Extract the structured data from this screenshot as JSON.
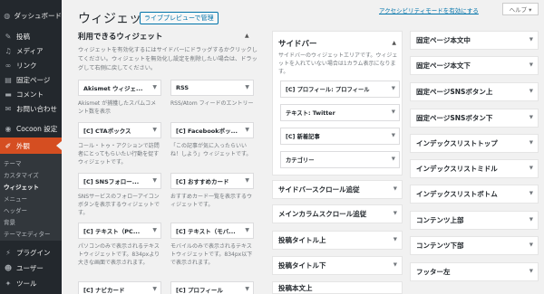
{
  "admin_menu": [
    {
      "label": "ダッシュボード",
      "icon": "dashboard-icon",
      "glyph": "◍"
    },
    {
      "label": "投稿",
      "icon": "pin-icon",
      "glyph": "✎"
    },
    {
      "label": "メディア",
      "icon": "media-icon",
      "glyph": "♫"
    },
    {
      "label": "リンク",
      "icon": "link-icon",
      "glyph": "∞"
    },
    {
      "label": "固定ページ",
      "icon": "page-icon",
      "glyph": "▤"
    },
    {
      "label": "コメント",
      "icon": "comment-icon",
      "glyph": "▬"
    },
    {
      "label": "お問い合わせ",
      "icon": "mail-icon",
      "glyph": "✉"
    },
    {
      "label": "Cocoon 設定",
      "icon": "cocoon-icon",
      "glyph": "◉"
    },
    {
      "label": "外観",
      "icon": "paintbrush-icon",
      "glyph": "✐"
    },
    {
      "label": "プラグイン",
      "icon": "plugin-icon",
      "glyph": "⚡"
    },
    {
      "label": "ユーザー",
      "icon": "user-icon",
      "glyph": "☻"
    },
    {
      "label": "ツール",
      "icon": "wrench-icon",
      "glyph": "✦"
    }
  ],
  "appearance_submenu": [
    "テーマ",
    "カスタマイズ",
    "ウィジェット",
    "メニュー",
    "ヘッダー",
    "背景",
    "テーマエディター"
  ],
  "header": {
    "title": "ウィジェット",
    "live_preview": "ライブプレビューで管理",
    "accessibility": "アクセシビリティモードを有効にする",
    "help": "ヘルプ ▾"
  },
  "available": {
    "title": "利用できるウィジェット",
    "description": "ウィジェットを有効化するにはサイドバーにドラッグするかクリックしてください。ウィジェットを無効化し設定を削除したい場合は、ドラッグして右側に戻してください。",
    "widgets": [
      {
        "name": "Akismet ウィジェ...",
        "desc": "Akismet が捕獲したスパムコメント数を表示"
      },
      {
        "name": "RSS",
        "desc": "RSS/Atom フィードのエントリー"
      },
      {
        "name": "[C] CTAボックス",
        "desc": "コール・トゥ・アクションで訪問者にとってもらいたい行動を促すウィジェットです。"
      },
      {
        "name": "[C] Facebookボッ...",
        "desc": "「この記事が気に入ったらいいね！しよう」ウィジェットです。"
      },
      {
        "name": "[C] SNSフォロー...",
        "desc": "SNSサービスのフォローアイコンボタンを表示するウィジェットです。"
      },
      {
        "name": "[C] おすすめカード",
        "desc": "おすすめカード一覧を表示するウィジェットです。"
      },
      {
        "name": "[C] テキスト（PC...",
        "desc": "パソコンのみで表示されるテキストウィジェットです。834pxより大きな画面で表示されます。"
      },
      {
        "name": "[C] テキスト（モバ...",
        "desc": "モバイルのみで表示されるテキストウィジェットです。834px以下で表示されます。"
      },
      {
        "name": "[C] ナビカード",
        "desc": ""
      },
      {
        "name": "[C] プロフィール",
        "desc": ""
      }
    ]
  },
  "sidebar_area": {
    "title": "サイドバー",
    "description": "サイドバーのウィジェットエリアです。ウィジェットを入れていない場合は1カラム表示になります。",
    "widgets": [
      "[C] プロフィール: プロフィール",
      "テキスト: Twitter",
      "[C] 新着記事",
      "カテゴリー"
    ]
  },
  "middle_areas": [
    "サイドバースクロール追従",
    "メインカラムスクロール追従",
    "投稿タイトル上",
    "投稿タイトル下",
    "投稿本文上"
  ],
  "right_areas": [
    "固定ページ本文中",
    "固定ページ本文下",
    "固定ページSNSボタン上",
    "固定ページSNSボタン下",
    "インデックスリストトップ",
    "インデックスリストミドル",
    "インデックスリストボトム",
    "コンテンツ上部",
    "コンテンツ下部",
    "フッター左"
  ],
  "arrow_glyph": "▼",
  "up_glyph": "▲"
}
